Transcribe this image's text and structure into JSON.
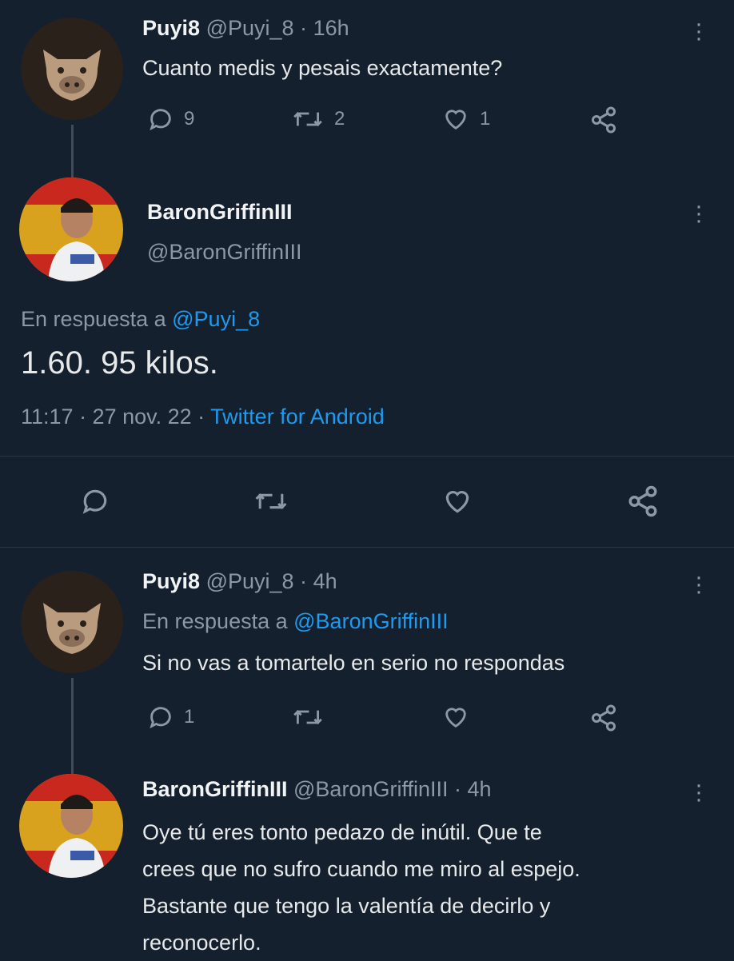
{
  "tweet1": {
    "name": "Puyi8",
    "handle": "@Puyi_8",
    "sep": "·",
    "time": "16h",
    "text": "Cuanto medis y pesais exactamente?",
    "replies": "9",
    "retweets": "2",
    "likes": "1"
  },
  "main": {
    "name": "BaronGriffinIII",
    "handle": "@BaronGriffinIII",
    "reply_prefix": "En respuesta a",
    "reply_to": "@Puyi_8",
    "text": "1.60. 95 kilos.",
    "time": "11:17 · 27 nov. 22 ·",
    "source": "Twitter for Android"
  },
  "tweet3": {
    "name": "Puyi8",
    "handle": "@Puyi_8",
    "sep": "·",
    "time": "4h",
    "reply_prefix": "En respuesta a",
    "reply_to": "@BaronGriffinIII",
    "text": "Si no vas a tomartelo en serio no respondas",
    "replies": "1"
  },
  "tweet4": {
    "name": "BaronGriffinIII",
    "handle": "@BaronGriffinIII",
    "sep": "·",
    "time": "4h",
    "text_lines": [
      "Oye tú eres tonto pedazo de inútil. Que te",
      "crees que no sufro cuando me miro al espejo.",
      "Bastante que tengo la valentía de decirlo y",
      "reconocerlo."
    ]
  },
  "icons": {
    "reply": "reply-icon",
    "retweet": "retweet-icon",
    "like": "heart-icon",
    "share": "share-icon",
    "more": "more-vertical-icon"
  },
  "colors": {
    "background": "#14202e",
    "link": "#1d9bf0",
    "muted": "#8b98a5"
  }
}
